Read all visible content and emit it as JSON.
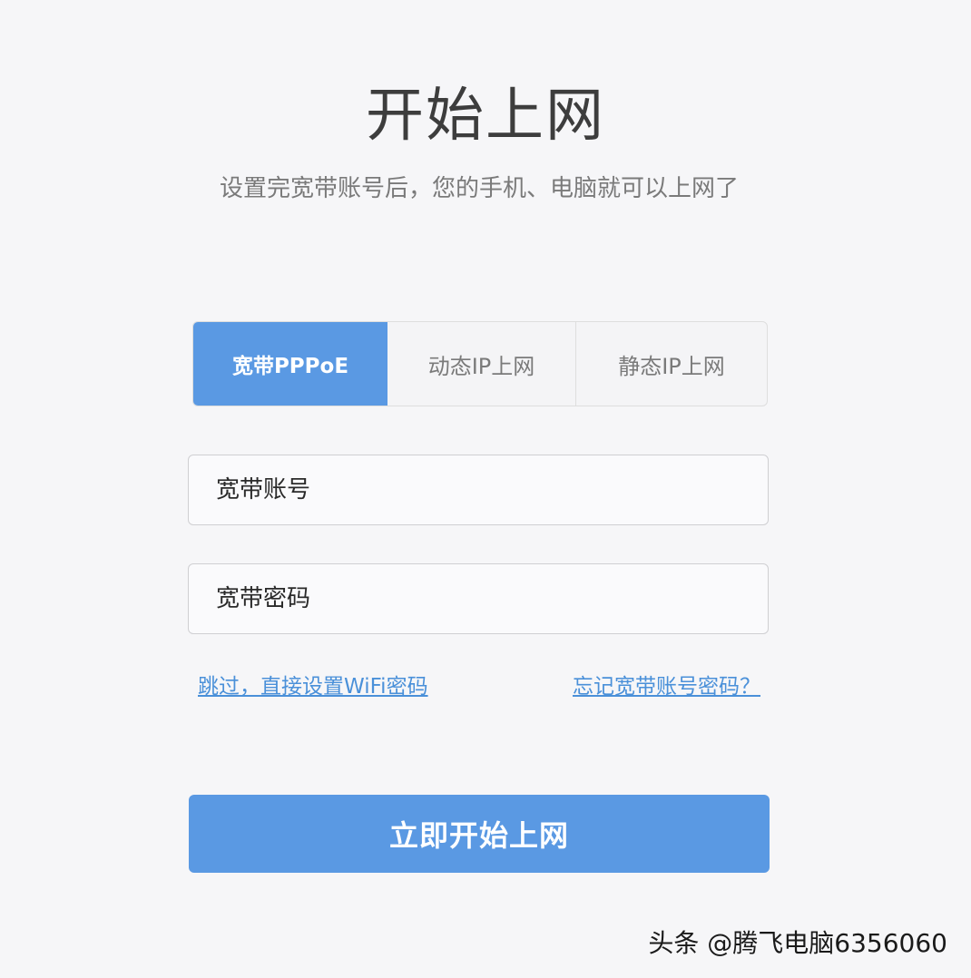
{
  "header": {
    "title": "开始上网",
    "subtitle": "设置完宽带账号后，您的手机、电脑就可以上网了"
  },
  "tabs": [
    {
      "label": "宽带PPPoE",
      "active": true
    },
    {
      "label": "动态IP上网",
      "active": false
    },
    {
      "label": "静态IP上网",
      "active": false
    }
  ],
  "form": {
    "account_placeholder": "宽带账号",
    "password_placeholder": "宽带密码"
  },
  "links": {
    "skip": "跳过，直接设置WiFi密码",
    "forgot": "忘记宽带账号密码？"
  },
  "submit_label": "立即开始上网",
  "watermark": "头条 @腾飞电脑6356060",
  "colors": {
    "accent": "#5a99e3",
    "link": "#4a90d9",
    "background": "#f6f6f8"
  }
}
